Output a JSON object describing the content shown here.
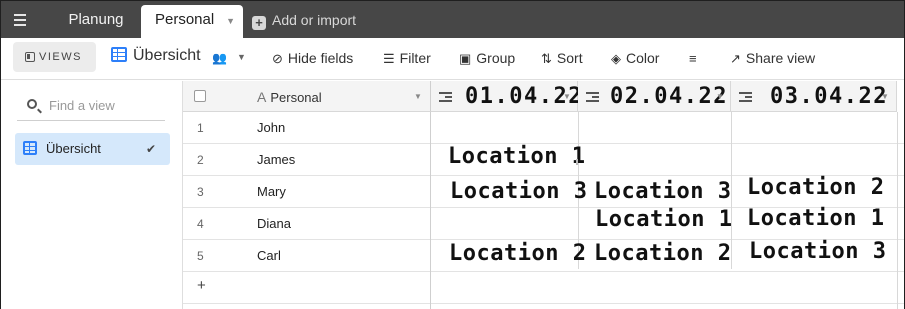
{
  "tabs": {
    "menu_icon": "hamburger-icon",
    "planung": "Planung",
    "personal": "Personal",
    "add_import": "Add or import"
  },
  "toolbar": {
    "views": "VIEWS",
    "view_name": "Übersicht",
    "hide_fields": "Hide fields",
    "filter": "Filter",
    "group": "Group",
    "sort": "Sort",
    "color": "Color",
    "share_view": "Share view"
  },
  "sidebar": {
    "find_placeholder": "Find a view",
    "items": [
      {
        "label": "Übersicht",
        "selected": true
      }
    ]
  },
  "grid": {
    "primary_column": "Personal",
    "date_columns": [
      "01.04.22",
      "02.04.22",
      "03.04.22"
    ],
    "rows": [
      {
        "num": "1",
        "name": "John",
        "cells": [
          "",
          "",
          ""
        ]
      },
      {
        "num": "2",
        "name": "James",
        "cells": [
          "Location 1",
          "",
          ""
        ]
      },
      {
        "num": "3",
        "name": "Mary",
        "cells": [
          "Location 3",
          "Location 3",
          "Location 2"
        ]
      },
      {
        "num": "4",
        "name": "Diana",
        "cells": [
          "",
          "Location 1",
          "Location 1"
        ]
      },
      {
        "num": "5",
        "name": "Carl",
        "cells": [
          "Location 2",
          "Location 2",
          "Location 3"
        ]
      }
    ],
    "add_row": "+"
  },
  "colors": {
    "tabbar_bg": "#474747",
    "accent_blue": "#2d7ff9",
    "sidebar_selected": "#d5e8fb"
  }
}
